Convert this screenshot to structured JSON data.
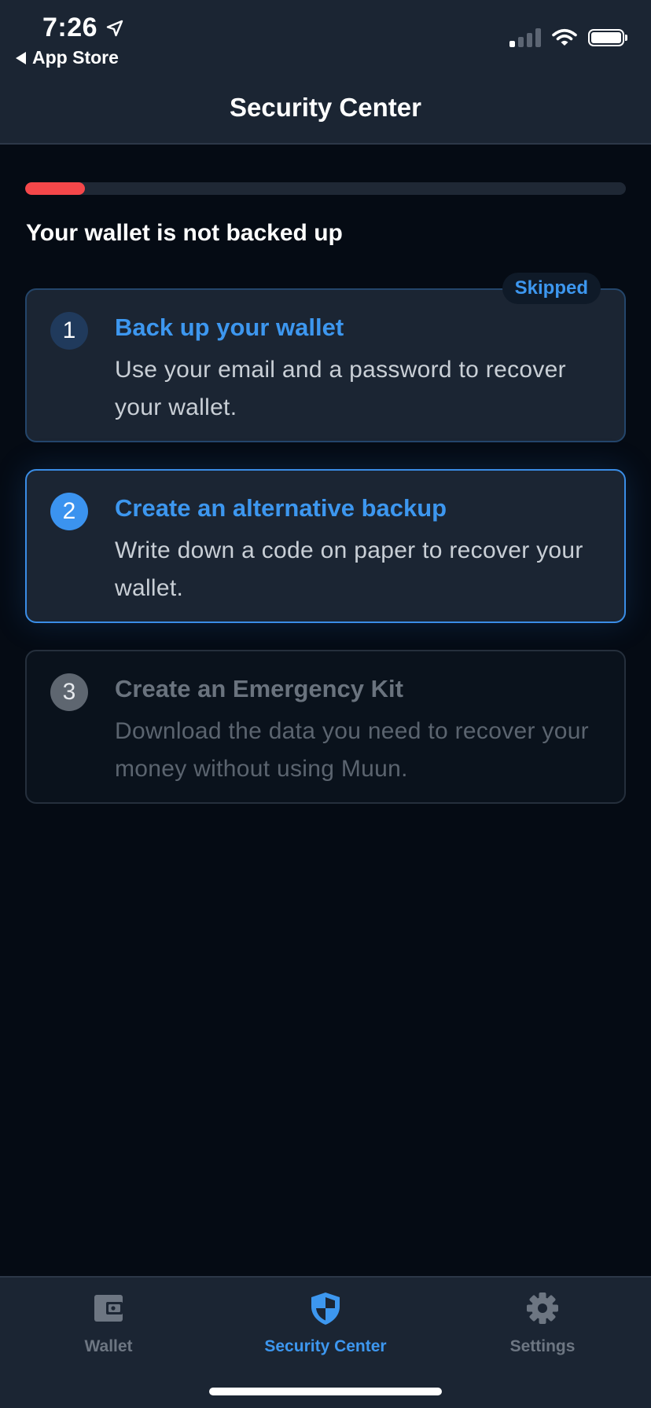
{
  "status_bar": {
    "time": "7:26",
    "back_label": "App Store"
  },
  "header": {
    "title": "Security Center"
  },
  "progress": {
    "fraction": 0.1,
    "color": "#f5474a",
    "track_color": "#1f2835"
  },
  "backup_status": "Your wallet is not backed up",
  "steps": [
    {
      "number": "1",
      "title": "Back up your wallet",
      "description": "Use your email and a password to recover your wallet.",
      "badge": "Skipped",
      "state": "skipped"
    },
    {
      "number": "2",
      "title": "Create an alternative backup",
      "description": "Write down a code on paper to recover your wallet.",
      "state": "active"
    },
    {
      "number": "3",
      "title": "Create an Emergency Kit",
      "description": "Download the data you need to recover your money without using Muun.",
      "state": "disabled"
    }
  ],
  "tabbar": {
    "tabs": [
      {
        "label": "Wallet",
        "icon": "wallet-icon",
        "active": false
      },
      {
        "label": "Security Center",
        "icon": "shield-icon",
        "active": true
      },
      {
        "label": "Settings",
        "icon": "gear-icon",
        "active": false
      }
    ]
  },
  "colors": {
    "accent": "#3d97ef",
    "background": "#050b14",
    "surface": "#1b2533",
    "inactive": "#6d7682"
  }
}
